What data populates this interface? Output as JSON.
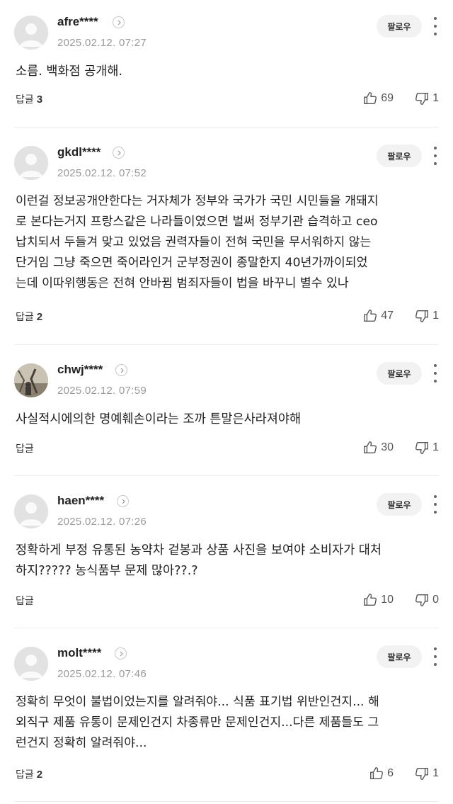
{
  "comments": [
    {
      "username": "afre****",
      "timestamp": "2025.02.12. 07:27",
      "follow_label": "팔로우",
      "text": "소름. 백화점 공개해.",
      "reply_label": "답글",
      "reply_count": "3",
      "likes": "69",
      "dislikes": "1"
    },
    {
      "username": "gkdl****",
      "timestamp": "2025.02.12. 07:52",
      "follow_label": "팔로우",
      "text": "이런걸 정보공개안한다는 거자체가 정부와 국가가 국민 시민들을 개돼지\n로 본다는거지 프랑스같은 나라들이였으면 벌써 정부기관 습격하고 ceo\n납치되서 두들겨 맞고 있었음 권력자들이 전혀 국민을 무서워하지 않는\n단거임 그냥 죽으면 죽어라인거 군부정권이 종말한지 40년가까이되었\n는데 이따위행동은 전혀 안바뀜 범죄자들이 법을 바꾸니 별수 있나",
      "reply_label": "답글",
      "reply_count": "2",
      "likes": "47",
      "dislikes": "1"
    },
    {
      "username": "chwj****",
      "timestamp": "2025.02.12. 07:59",
      "follow_label": "팔로우",
      "text": "사실적시에의한 명예훼손이라는 조까 튼말은사라져야해",
      "reply_label": "답글",
      "reply_count": "",
      "likes": "30",
      "dislikes": "1"
    },
    {
      "username": "haen****",
      "timestamp": "2025.02.12. 07:26",
      "follow_label": "팔로우",
      "text": "정확하게 부정 유통된 농약차 겉봉과 상품 사진을 보여야 소비자가 대처\n하지????? 농식품부 문제 많아??.?",
      "reply_label": "답글",
      "reply_count": "",
      "likes": "10",
      "dislikes": "0"
    },
    {
      "username": "molt****",
      "timestamp": "2025.02.12. 07:46",
      "follow_label": "팔로우",
      "text": "정확히 무엇이 불법이었는지를 알려줘야... 식품 표기법 위반인건지... 해\n외직구 제품 유통이 문제인건지 차종류만 문제인건지...다른 제품들도 그\n런건지 정확히 알려줘야...",
      "reply_label": "답글",
      "reply_count": "2",
      "likes": "6",
      "dislikes": "1"
    }
  ],
  "icons": {
    "avatar": "default-avatar-icon",
    "profile": "chevron-right-icon",
    "more": "vertical-ellipsis-icon",
    "like": "thumbs-up-icon",
    "dislike": "thumbs-down-icon"
  }
}
